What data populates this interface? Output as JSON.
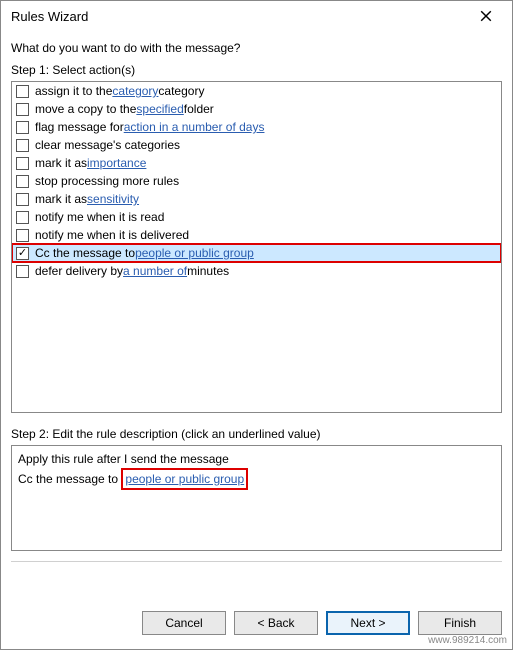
{
  "window": {
    "title": "Rules Wizard"
  },
  "prompt": "What do you want to do with the message?",
  "step1_label": "Step 1: Select action(s)",
  "actions": [
    {
      "checked": false,
      "parts": [
        {
          "t": "assign it to the "
        },
        {
          "t": "category",
          "link": true
        },
        {
          "t": " category"
        }
      ]
    },
    {
      "checked": false,
      "parts": [
        {
          "t": "move a copy to the "
        },
        {
          "t": "specified",
          "link": true
        },
        {
          "t": " folder"
        }
      ]
    },
    {
      "checked": false,
      "parts": [
        {
          "t": "flag message for "
        },
        {
          "t": "action in a number of days",
          "link": true
        }
      ]
    },
    {
      "checked": false,
      "parts": [
        {
          "t": "clear message's categories"
        }
      ]
    },
    {
      "checked": false,
      "parts": [
        {
          "t": "mark it as "
        },
        {
          "t": "importance",
          "link": true
        }
      ]
    },
    {
      "checked": false,
      "parts": [
        {
          "t": "stop processing more rules"
        }
      ]
    },
    {
      "checked": false,
      "parts": [
        {
          "t": "mark it as "
        },
        {
          "t": "sensitivity",
          "link": true
        }
      ]
    },
    {
      "checked": false,
      "parts": [
        {
          "t": "notify me when it is read"
        }
      ]
    },
    {
      "checked": false,
      "parts": [
        {
          "t": "notify me when it is delivered"
        }
      ]
    },
    {
      "checked": true,
      "selected": true,
      "redbox": true,
      "parts": [
        {
          "t": "Cc the message to "
        },
        {
          "t": "people or public group",
          "link": true
        }
      ]
    },
    {
      "checked": false,
      "parts": [
        {
          "t": "defer delivery by "
        },
        {
          "t": "a number of",
          "link": true
        },
        {
          "t": " minutes"
        }
      ]
    }
  ],
  "step2_label": "Step 2: Edit the rule description (click an underlined value)",
  "description": {
    "line1": "Apply this rule after I send the message",
    "line2_prefix": "Cc the message to ",
    "line2_link": "people or public group"
  },
  "buttons": {
    "cancel": "Cancel",
    "back": "< Back",
    "next": "Next >",
    "finish": "Finish"
  },
  "watermark": "www.989214.com"
}
